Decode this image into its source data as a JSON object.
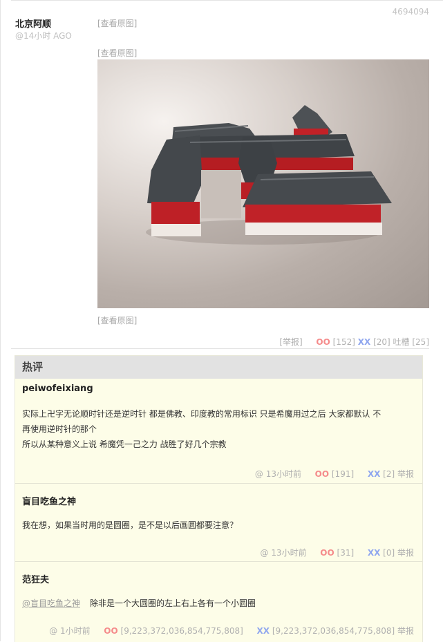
{
  "post": {
    "id": "4694094",
    "author": "北京阿顺",
    "time": "@14小时 AGO",
    "view_original_label": "[查看原图]",
    "actions": {
      "report": "[举报]",
      "oo_label": "OO",
      "oo_count": "[152]",
      "xx_label": "XX",
      "xx_count": "[20]",
      "tucao": "吐槽 [25]"
    }
  },
  "hot_comments": {
    "title": "热评",
    "items": [
      {
        "author": "peiwofeixiang",
        "lines": [
          "实际上卍字无论顺时针还是逆时针 都是佛教、印度教的常用标识 只是希魔用过之后 大家都默认 不",
          "再使用逆时针的那个",
          "所以从某种意义上说 希魔凭一己之力 战胜了好几个宗教"
        ],
        "time": "@ 13小时前",
        "oo_label": "OO",
        "oo_count": "[191]",
        "xx_label": "XX",
        "xx_count": "[2]",
        "report": "举报"
      },
      {
        "author": "盲目吃鱼之神",
        "lines": [
          "我在想，如果当时用的是圆圈，是不是以后画圆都要注意？"
        ],
        "time": "@ 13小时前",
        "oo_label": "OO",
        "oo_count": "[31]",
        "xx_label": "XX",
        "xx_count": "[0]",
        "report": "举报"
      },
      {
        "author": "范狂夫",
        "mention": "@盲目吃鱼之神",
        "text": "除非是一个大圆圈的左上右上各有一个小圆圈",
        "time": "@ 1小时前",
        "oo_label": "OO",
        "oo_count": "[9,223,372,036,854,775,808]",
        "xx_label": "XX",
        "xx_count": "[9,223,372,036,854,775,808]",
        "report": "举报"
      }
    ]
  },
  "colors": {
    "oo": "#f58b8b",
    "xx": "#8fa6ef",
    "hot_bg": "#fdfde8",
    "hot_header_bg": "#e2e2e2"
  }
}
